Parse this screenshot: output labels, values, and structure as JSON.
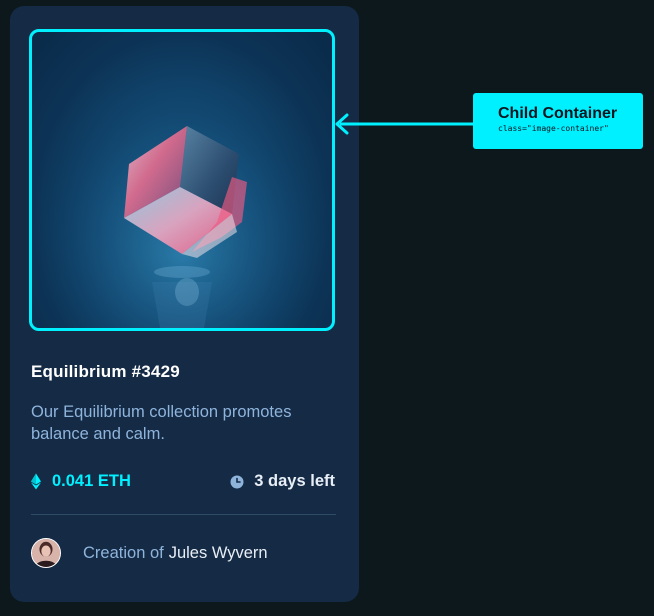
{
  "card": {
    "title": "Equilibrium #3429",
    "description": "Our Equilibrium collection promotes balance and calm.",
    "price": "0.041 ETH",
    "time_left": "3 days left",
    "creator_prefix": "Creation of",
    "creator_name": "Jules Wyvern",
    "icons": {
      "price": "ethereum-icon",
      "time": "clock-icon"
    }
  },
  "annotation": {
    "title": "Child Container",
    "subtitle": "class=\"image-container\""
  },
  "colors": {
    "background": "#0c181c",
    "card": "#142a45",
    "accent": "#00f0ff",
    "soft_blue": "#8fb4dc",
    "white": "#ffffff"
  }
}
